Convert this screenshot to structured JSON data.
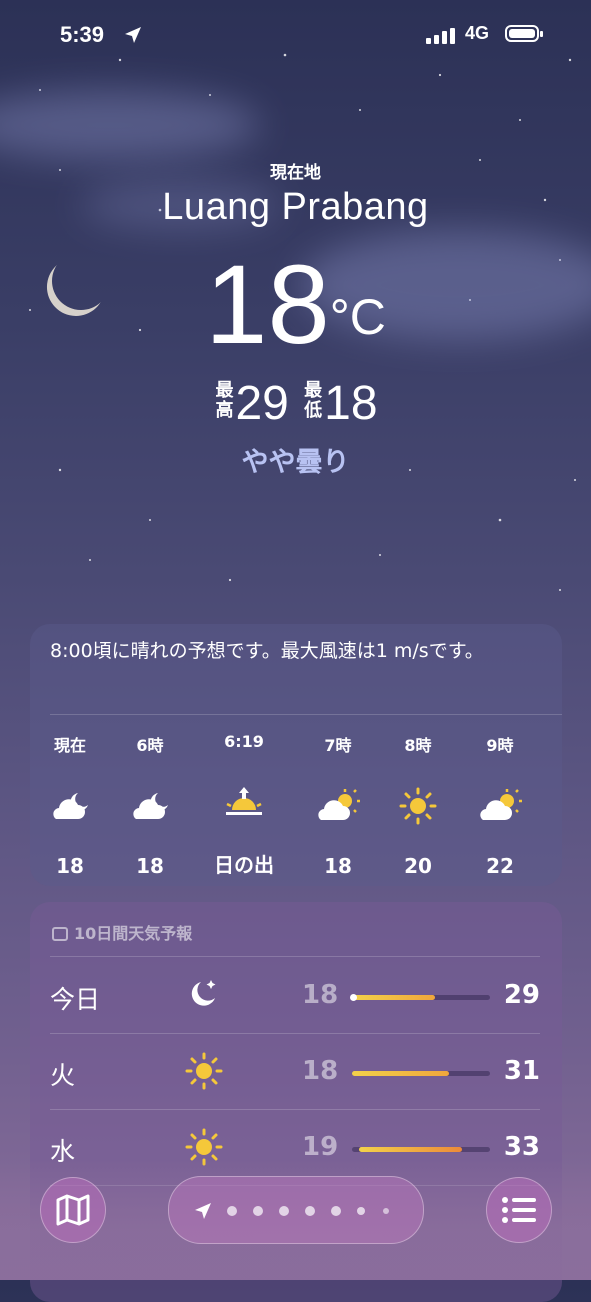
{
  "status_bar": {
    "time": "5:39",
    "network": "4G"
  },
  "header": {
    "location_label": "現在地",
    "city": "Luang Prabang",
    "temperature": "18",
    "unit": "°C",
    "high_label": "最高",
    "high": "29",
    "low_label": "最低",
    "low": "18",
    "condition": "やや曇り"
  },
  "hourly": {
    "summary": "8:00頃に晴れの予想です。最大風速は1 m/sです。",
    "items": [
      {
        "label": "現在",
        "icon": "partly-cloudy-night-icon",
        "value": "18"
      },
      {
        "label": "6時",
        "icon": "partly-cloudy-night-icon",
        "value": "18"
      },
      {
        "label": "6:19",
        "icon": "sunrise-icon",
        "value": "日の出"
      },
      {
        "label": "7時",
        "icon": "partly-cloudy-day-icon",
        "value": "18"
      },
      {
        "label": "8時",
        "icon": "sun-icon",
        "value": "20"
      },
      {
        "label": "9時",
        "icon": "partly-cloudy-day-icon",
        "value": "22"
      }
    ]
  },
  "daily": {
    "title": "10日間天気予報",
    "rows": [
      {
        "day": "今日",
        "icon": "moon-stars-icon",
        "low": "18",
        "high": "29",
        "range_start": 0.0,
        "range_end": 0.6,
        "current": 0.0
      },
      {
        "day": "火",
        "icon": "sun-icon",
        "low": "18",
        "high": "31",
        "range_start": 0.0,
        "range_end": 0.7
      },
      {
        "day": "水",
        "icon": "sun-icon",
        "low": "19",
        "high": "33",
        "range_start": 0.05,
        "range_end": 0.8
      }
    ]
  },
  "colors": {
    "accent": "#b8c2f2",
    "sun": "#f5c83a",
    "bar_warm": "#f0a63c",
    "bar_cool": "#f3d24a"
  }
}
